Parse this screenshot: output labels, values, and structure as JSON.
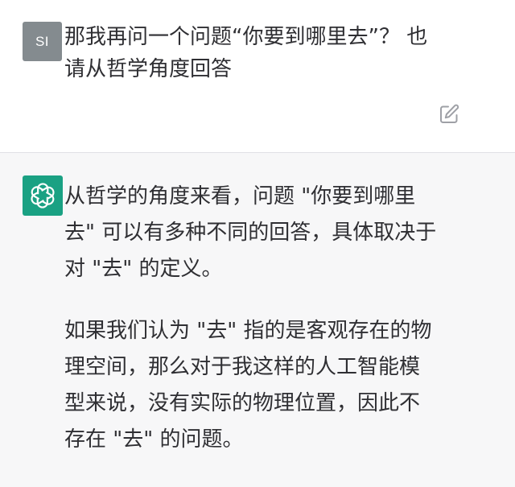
{
  "user_message": {
    "avatar_initials": "SI",
    "line1": "那我再问一个问题“你要到哪里去”？ 也",
    "line2": "请从哲学角度回答"
  },
  "assistant_message": {
    "paragraph1": {
      "line1": "从哲学的角度来看，问题 \"你要到哪里",
      "line2": "去\" 可以有多种不同的回答，具体取决于",
      "line3": "对 \"去\" 的定义。"
    },
    "paragraph2": {
      "line1": "如果我们认为 \"去\" 指的是客观存在的物",
      "line2": "理空间，那么对于我这样的人工智能模",
      "line3": "型来说，没有实际的物理位置，因此不",
      "line4": "存在 \"去\" 的问题。"
    }
  },
  "icons": {
    "edit": "edit-icon",
    "assistant_logo": "openai-logo-icon"
  },
  "colors": {
    "user_avatar_bg": "#848b8f",
    "assistant_avatar_bg": "#1aa183",
    "assistant_block_bg": "#f7f7f8",
    "text": "#2f2f33"
  }
}
